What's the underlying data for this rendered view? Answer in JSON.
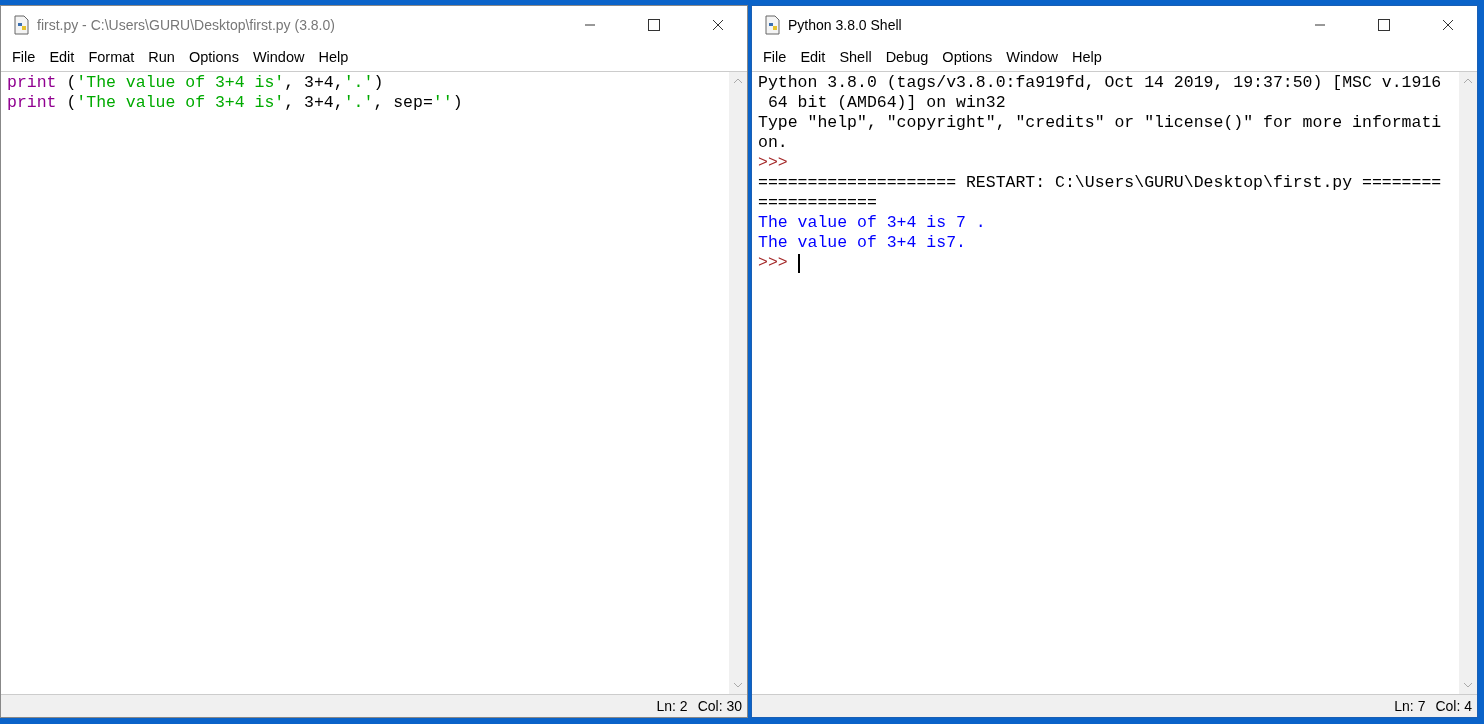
{
  "editor": {
    "title": "first.py - C:\\Users\\GURU\\Desktop\\first.py (3.8.0)",
    "active": false,
    "menu": [
      "File",
      "Edit",
      "Format",
      "Run",
      "Options",
      "Window",
      "Help"
    ],
    "lines": [
      [
        {
          "kind": "builtin",
          "text": "print"
        },
        {
          "kind": "plain",
          "text": " ("
        },
        {
          "kind": "string",
          "text": "'The value of 3+4 is'"
        },
        {
          "kind": "plain",
          "text": ", 3+4,"
        },
        {
          "kind": "string",
          "text": "'.'"
        },
        {
          "kind": "plain",
          "text": ")"
        }
      ],
      [
        {
          "kind": "builtin",
          "text": "print"
        },
        {
          "kind": "plain",
          "text": " ("
        },
        {
          "kind": "string",
          "text": "'The value of 3+4 is'"
        },
        {
          "kind": "plain",
          "text": ", 3+4,"
        },
        {
          "kind": "string",
          "text": "'.'"
        },
        {
          "kind": "plain",
          "text": ", sep="
        },
        {
          "kind": "string",
          "text": "''"
        },
        {
          "kind": "plain",
          "text": ")"
        }
      ]
    ],
    "status": {
      "line": "Ln: 2",
      "col": "Col: 30"
    }
  },
  "shell": {
    "title": "Python 3.8.0 Shell",
    "active": true,
    "menu": [
      "File",
      "Edit",
      "Shell",
      "Debug",
      "Options",
      "Window",
      "Help"
    ],
    "lines": [
      {
        "kind": "plain",
        "text": "Python 3.8.0 (tags/v3.8.0:fa919fd, Oct 14 2019, 19:37:50) [MSC v.1916"
      },
      {
        "kind": "plain",
        "text": " 64 bit (AMD64)] on win32"
      },
      {
        "kind": "plain",
        "text": "Type \"help\", \"copyright\", \"credits\" or \"license()\" for more informati"
      },
      {
        "kind": "plain",
        "text": "on."
      },
      {
        "kind": "prompt",
        "text": ">>>"
      },
      {
        "kind": "plain",
        "text": "==================== RESTART: C:\\Users\\GURU\\Desktop\\first.py ========"
      },
      {
        "kind": "plain",
        "text": "============"
      },
      {
        "kind": "output",
        "text": "The value of 3+4 is 7 ."
      },
      {
        "kind": "output",
        "text": "The value of 3+4 is7."
      },
      {
        "kind": "prompt",
        "text": ">>>",
        "cursor": true
      }
    ],
    "status": {
      "line": "Ln: 7",
      "col": "Col: 4"
    }
  }
}
